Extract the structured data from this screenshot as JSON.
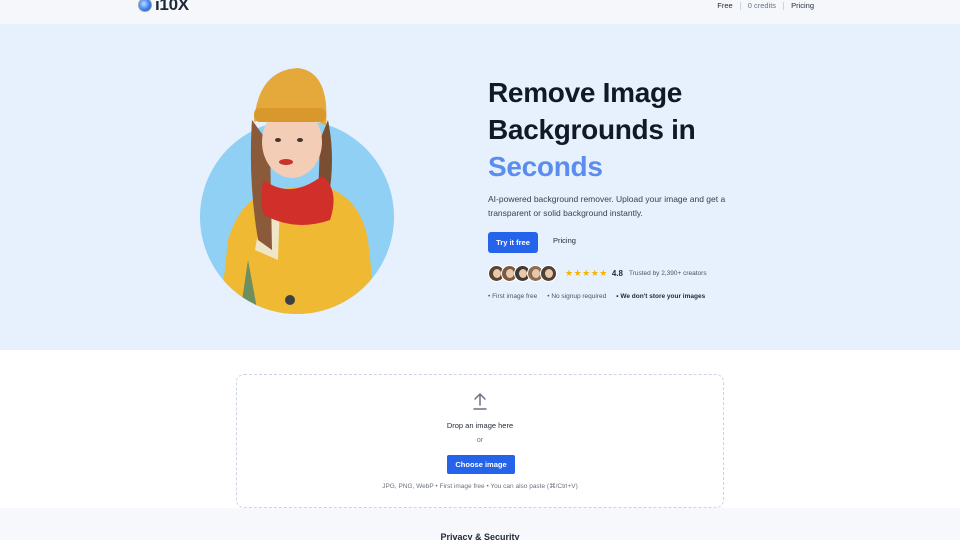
{
  "header": {
    "brand": "i10X",
    "nav": {
      "free": "Free",
      "credits": "0 credits",
      "pricing": "Pricing"
    }
  },
  "hero": {
    "title_line1": "Remove Image",
    "title_line2": "Backgrounds in",
    "title_accent": "Seconds",
    "description": "AI-powered background remover. Upload your image and get a transparent or solid background instantly.",
    "cta_primary": "Try it free",
    "cta_secondary": "Pricing",
    "stars": "★★★★★",
    "rating": "4.8",
    "trusted": "Trusted by 2,390+ creators",
    "features": [
      "• First image free",
      "• No signup required",
      "• We don't store your images"
    ],
    "accent_color": "#5b8def"
  },
  "upload": {
    "drop_text": "Drop an image here",
    "or_text": "or",
    "choose_button": "Choose image",
    "formats": "JPG, PNG, WebP • First image free • You can also paste (⌘/Ctrl+V)"
  },
  "privacy": {
    "title": "Privacy & Security"
  },
  "colors": {
    "primary": "#2563eb",
    "hero_bg": "#e6f1fd",
    "star": "#f5b301"
  }
}
